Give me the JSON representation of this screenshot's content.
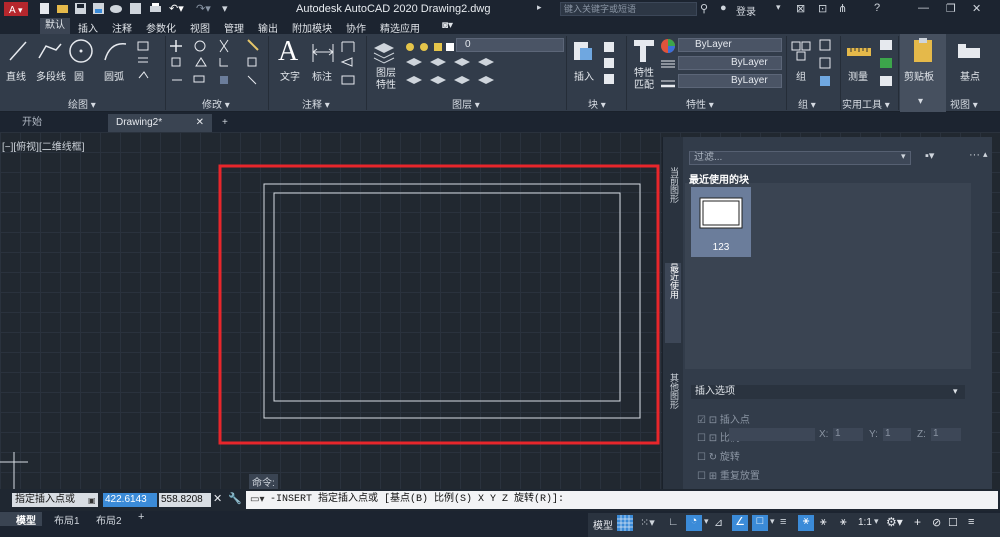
{
  "app": {
    "title": "Autodesk AutoCAD 2020    Drawing2.dwg",
    "search_placeholder": "键入关键字或短语",
    "login": "登录"
  },
  "ribbon_tabs": [
    "默认",
    "插入",
    "注释",
    "参数化",
    "视图",
    "管理",
    "输出",
    "附加模块",
    "协作",
    "精选应用"
  ],
  "ribbon": {
    "draw": {
      "line": "直线",
      "polyline": "多段线",
      "circle": "圆",
      "arc": "圆弧",
      "panel": "绘图 ▾"
    },
    "modify": {
      "panel": "修改 ▾"
    },
    "annotation": {
      "text": "文字",
      "dimension": "标注",
      "panel": "注释 ▾"
    },
    "layers": {
      "layer_props": "图层\n特性",
      "layer_value": "0",
      "panel": "图层 ▾"
    },
    "block": {
      "insert": "插入",
      "panel": "块 ▾"
    },
    "properties": {
      "match": "特性\n匹配",
      "color": "ByLayer",
      "linetype": "ByLayer",
      "lineweight": "ByLayer",
      "panel": "特性 ▾"
    },
    "groups": {
      "group": "组",
      "panel": "组 ▾"
    },
    "utilities": {
      "measure": "测量",
      "panel": "实用工具 ▾"
    },
    "clipboard": {
      "label": "剪贴板"
    },
    "view": {
      "base": "基点",
      "panel": "视图 ▾"
    }
  },
  "doc_tabs": [
    "开始",
    "Drawing2*"
  ],
  "viewport_label": "[−][俯视][二维线框]",
  "palette": {
    "filter": "过滤...",
    "recent_title": "最近使用的块",
    "block_name": "123",
    "side_tabs": [
      "当前图形",
      "最近使用",
      "其他图形"
    ],
    "insert_options": "插入选项",
    "opt_insert_point": "插入点",
    "opt_scale": "比例",
    "opt_rotation": "旋转",
    "opt_repeat": "重复放置",
    "x": "X:",
    "x_val": "1",
    "y": "Y:",
    "y_val": "1",
    "z": "Z:",
    "z_val": "1"
  },
  "command": {
    "label": "命令:",
    "prompt_box": "指定插入点或",
    "coord_x": "422.6143",
    "coord_y": "558.8208",
    "text": "-INSERT 指定插入点或 [基点(B) 比例(S) X Y Z 旋转(R)]:"
  },
  "status_tabs": [
    "模型",
    "布局1",
    "布局2"
  ],
  "status": {
    "model": "模型",
    "scale": "1:1"
  },
  "colors": {
    "highlight": "#e8262b",
    "accent": "#3b8bd8"
  }
}
